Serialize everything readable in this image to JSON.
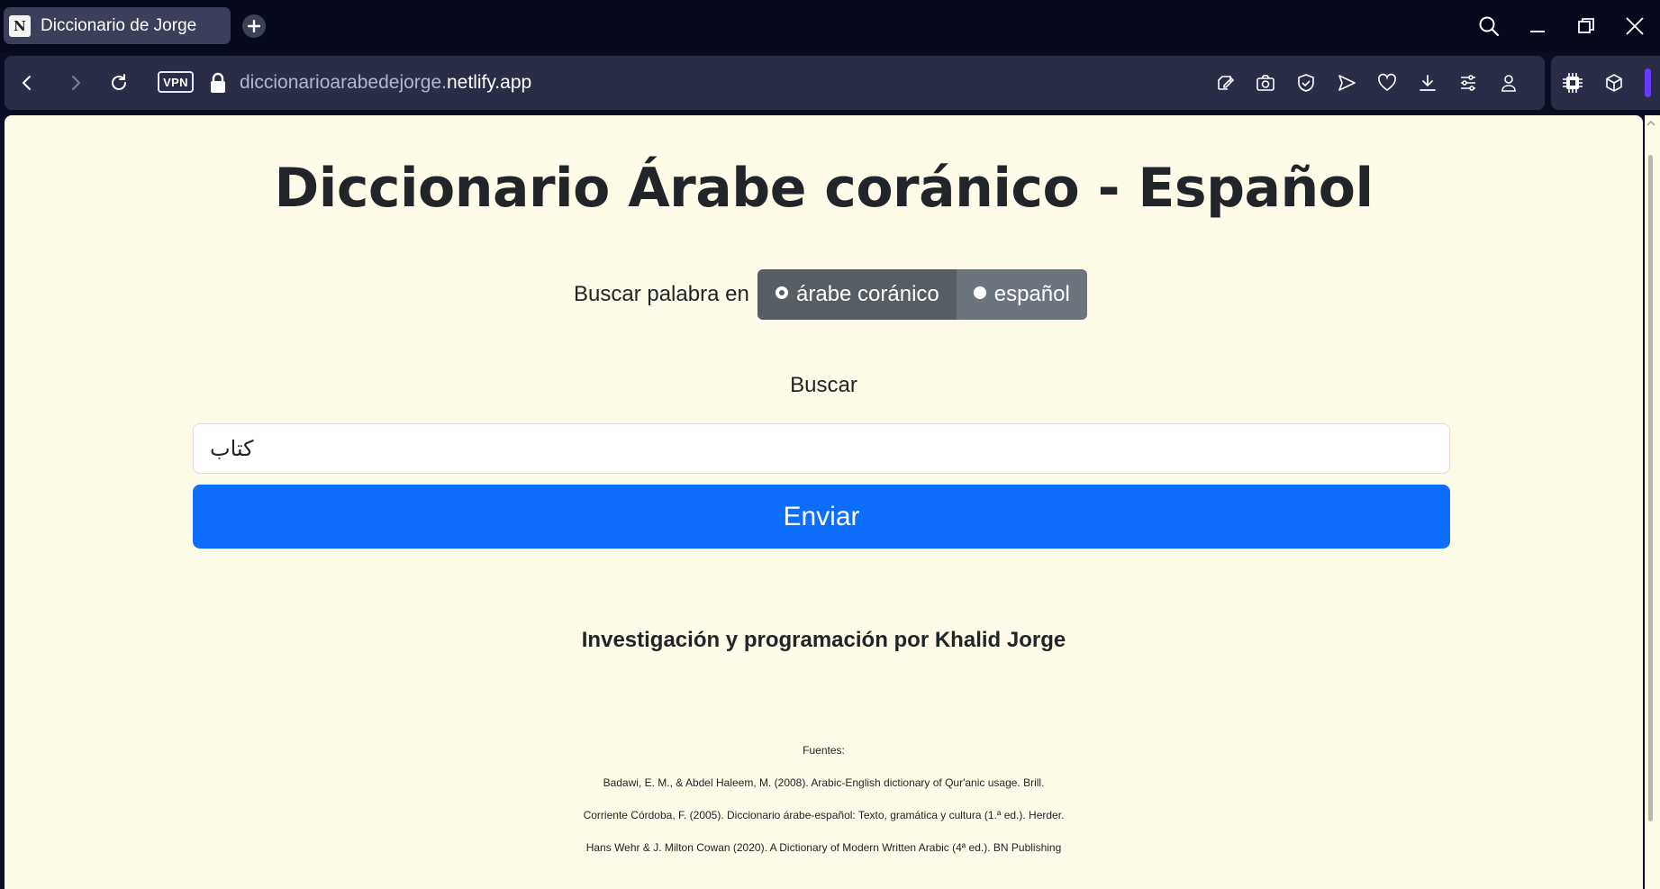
{
  "browser": {
    "tab": {
      "title": "Diccionario de Jorge",
      "favicon_letter": "N"
    },
    "address": {
      "vpn_label": "VPN",
      "url_subdomain": "diccionarioarabedejorge.",
      "url_host": "netlify.app"
    }
  },
  "page": {
    "title": "Diccionario Árabe coránico - Español",
    "search_in_label": "Buscar palabra en",
    "options": [
      {
        "label": "árabe coránico",
        "checked": true
      },
      {
        "label": "español",
        "checked": false
      }
    ],
    "search_label": "Buscar",
    "search_value": "كتاب",
    "submit_label": "Enviar",
    "credit": "Investigación y programación por Khalid Jorge",
    "sources_title": "Fuentes:",
    "sources": [
      "Badawi, E. M., & Abdel Haleem, M. (2008). Arabic-English dictionary of Qur'anic usage. Brill.",
      "Corriente Córdoba, F. (2005). Diccionario árabe-español: Texto, gramática y cultura (1.ª ed.). Herder.",
      "Hans Wehr & J. Milton Cowan (2020). A Dictionary of Modern Written Arabic (4ª ed.). BN Publishing"
    ]
  },
  "colors": {
    "page_bg": "#fefbe9",
    "primary": "#0d6efd",
    "toggle_active": "#565e64",
    "toggle_idle": "#6c757d"
  }
}
